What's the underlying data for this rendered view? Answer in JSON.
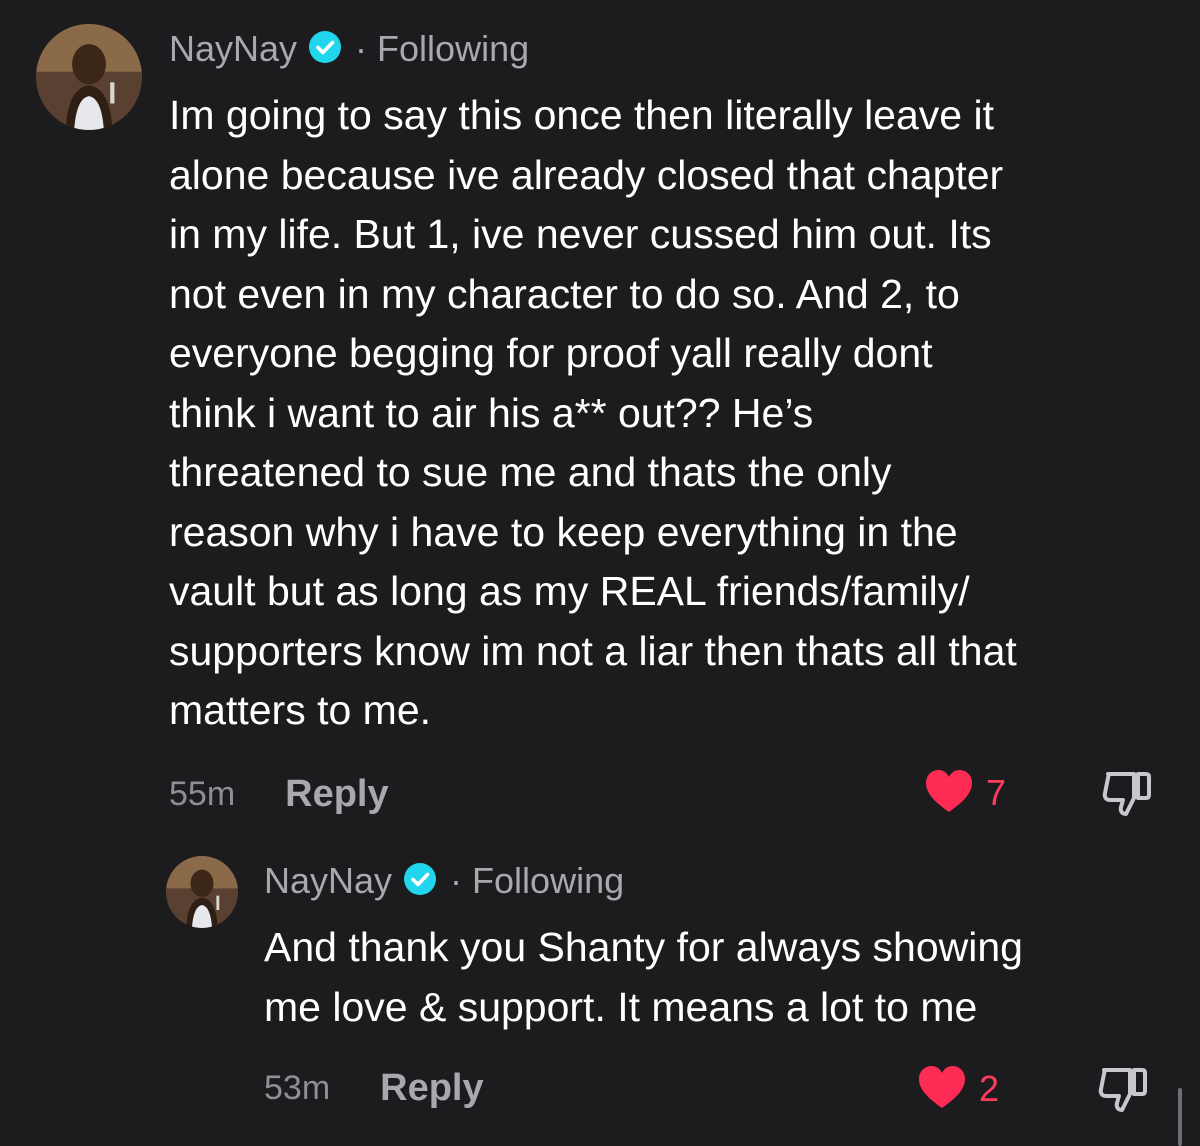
{
  "comments": [
    {
      "username": "NayNay",
      "separator": "·",
      "follow_status": "Following",
      "text": "Im going to say this once then literally leave it\nalone because ive already closed that chapter\nin my life. But 1, ive never cussed him out. Its\nnot even in my character to do so. And 2, to\neveryone begging for proof yall really dont\nthink i want to air his a** out?? He’s\nthreatened to sue me and thats the only\nreason why i have to keep everything in the\nvault but as long as my REAL friends/family/\nsupporters know im not a liar then thats all that\nmatters to me.",
      "timestamp": "55m",
      "reply_label": "Reply",
      "like_count": "7",
      "liked": true
    },
    {
      "username": "NayNay",
      "separator": "·",
      "follow_status": "Following",
      "text": "And thank you Shanty for always showing\nme love & support. It means a lot to me",
      "timestamp": "53m",
      "reply_label": "Reply",
      "like_count": "2",
      "liked": true
    }
  ],
  "colors": {
    "background": "#1c1c1e",
    "verified_badge": "#20d5ec",
    "like_heart": "#fe2c55",
    "meta_text": "#a8a8ad"
  },
  "icons": {
    "verified": "verified-badge-icon",
    "like": "heart-icon",
    "dislike": "thumbs-down-icon"
  }
}
